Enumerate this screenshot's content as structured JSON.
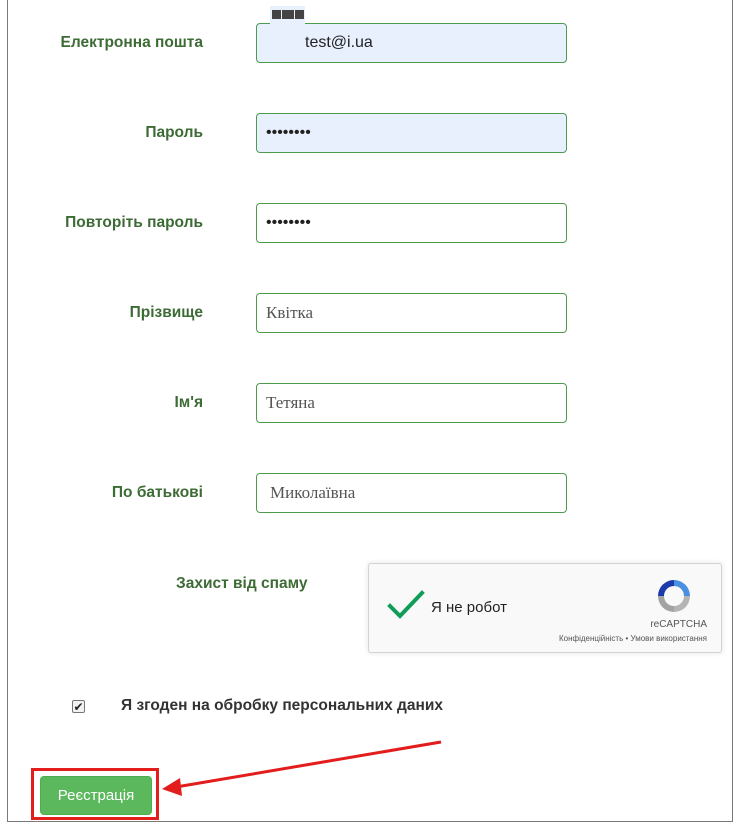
{
  "form": {
    "email": {
      "label": "Електронна пошта",
      "value": "test@i.ua"
    },
    "password": {
      "label": "Пароль",
      "value": "••••••••"
    },
    "password_repeat": {
      "label": "Повторіть пароль",
      "value": "••••••••"
    },
    "last_name": {
      "label": "Прізвище",
      "value": "Квітка"
    },
    "first_name": {
      "label": "Ім'я",
      "value": "Тетяна"
    },
    "patronymic": {
      "label": "По батькові",
      "value": "Миколаївна"
    }
  },
  "captcha": {
    "label": "Захист від спаму",
    "checkbox_text": "Я не робот",
    "brand": "reCAPTCHA",
    "links": "Конфіденційність • Умови використання",
    "checked": true,
    "check_color": "#0f9d58"
  },
  "agreement": {
    "text": "Я згоден на обробку персональних даних",
    "checked": true
  },
  "submit": {
    "label": "Реєстрація",
    "color": "#5cb85c"
  },
  "annotation": {
    "color": "#e31c1c"
  },
  "colors": {
    "label": "#3d6b35",
    "field_border": "#4f9b4e",
    "autofill_bg": "#e8f0fe"
  }
}
